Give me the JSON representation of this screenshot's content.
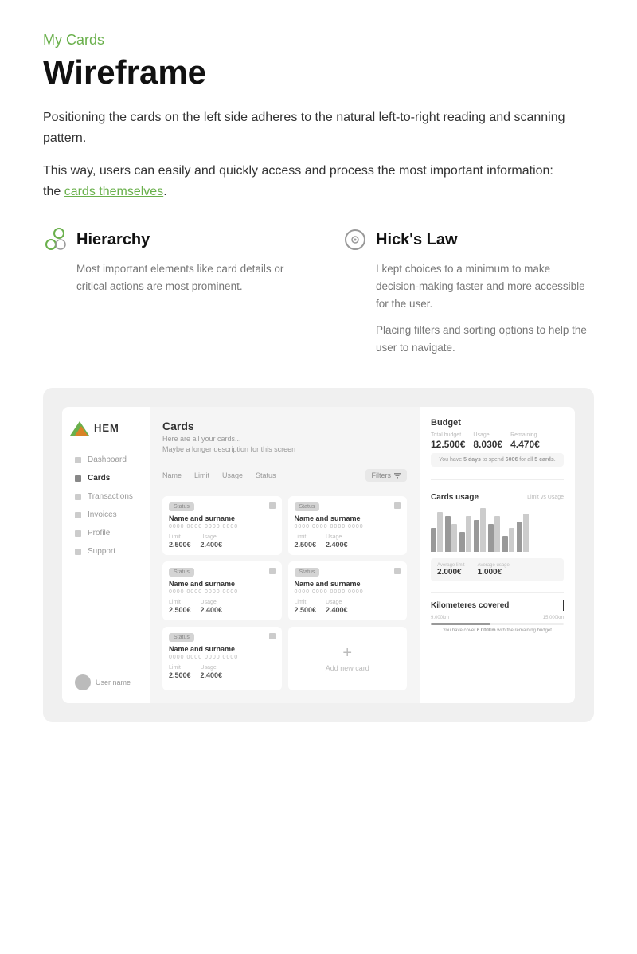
{
  "header": {
    "section_label": "My Cards",
    "page_title": "Wireframe",
    "description_1": "Positioning the cards on the left side adheres to the natural left-to-right reading and scanning pattern.",
    "description_2": "This way, users can easily and quickly access and process the most important information:",
    "cards_link_prefix": "the ",
    "cards_link_text": "cards themselves",
    "cards_link_suffix": "."
  },
  "principles": [
    {
      "id": "hierarchy",
      "title": "Hierarchy",
      "description": "Most important elements like card details or critical actions are most prominent."
    },
    {
      "id": "hicks-law",
      "title": "Hick's Law",
      "description_1": "I kept choices to a minimum to make decision-making faster and more accessible for the user.",
      "description_2": "Placing filters and sorting options to help the user to navigate."
    }
  ],
  "mockup": {
    "sidebar": {
      "logo_text": "HEM",
      "nav_items": [
        {
          "label": "Dashboard",
          "active": false
        },
        {
          "label": "Cards",
          "active": true
        },
        {
          "label": "Transactions",
          "active": false
        },
        {
          "label": "Invoices",
          "active": false
        },
        {
          "label": "Profile",
          "active": false
        },
        {
          "label": "Support",
          "active": false
        }
      ],
      "user_name": "User name"
    },
    "main": {
      "title": "Cards",
      "description_1": "Here are all your cards...",
      "description_2": "Maybe a longer description for this screen",
      "columns": [
        "Name",
        "Limit",
        "Usage",
        "Status"
      ],
      "filters_label": "Filters",
      "cards": [
        {
          "status": "Status",
          "name": "Name and surname",
          "number": "0000 0000 0000 0000",
          "limit_label": "Limit",
          "limit_value": "2.500€",
          "usage_label": "Usage",
          "usage_value": "2.400€"
        },
        {
          "status": "Status",
          "name": "Name and surname",
          "number": "0000 0000 0000 0000",
          "limit_label": "Limit",
          "limit_value": "2.500€",
          "usage_label": "Usage",
          "usage_value": "2.400€"
        },
        {
          "status": "Status",
          "name": "Name and surname",
          "number": "0000 0000 0000 0000",
          "limit_label": "Limit",
          "limit_value": "2.500€",
          "usage_label": "Usage",
          "usage_value": "2.400€"
        },
        {
          "status": "Status",
          "name": "Name and surname",
          "number": "0000 0000 0000 0000",
          "limit_label": "Limit",
          "limit_value": "2.500€",
          "usage_label": "Usage",
          "usage_value": "2.400€"
        },
        {
          "status": "Status",
          "name": "Name and surname",
          "number": "0000 0000 0000 0000",
          "limit_label": "Limit",
          "limit_value": "2.500€",
          "usage_label": "Usage",
          "usage_value": "2.400€"
        }
      ],
      "add_card_label": "Add new card"
    },
    "budget": {
      "title": "Budget",
      "total_budget_label": "Total budget",
      "total_budget_value": "12.500€",
      "usage_label": "Usage",
      "usage_value": "8.030€",
      "remaining_label": "Remaining",
      "remaining_value": "4.470€",
      "note": "You have 5 days to spend 600€ for all 5 cards.",
      "cards_usage_title": "Cards usage",
      "limit_vs_usage": "Limit vs Usage",
      "avg_limit_label": "Average limit",
      "avg_limit_value": "2.000€",
      "avg_usage_label": "Average usage",
      "avg_usage_value": "1.000€",
      "km_title": "Kilometeres covered",
      "km_min": "9.000km",
      "km_max": "15.000km",
      "km_note": "You have cover 6.000km with the remaining budget",
      "bar_data": [
        {
          "dark": 30,
          "light": 50
        },
        {
          "dark": 45,
          "light": 35
        },
        {
          "dark": 25,
          "light": 45
        },
        {
          "dark": 40,
          "light": 55
        },
        {
          "dark": 35,
          "light": 45
        },
        {
          "dark": 20,
          "light": 30
        },
        {
          "dark": 38,
          "light": 48
        }
      ]
    }
  },
  "colors": {
    "accent_green": "#6ab04c",
    "accent_orange": "#e67e22"
  }
}
